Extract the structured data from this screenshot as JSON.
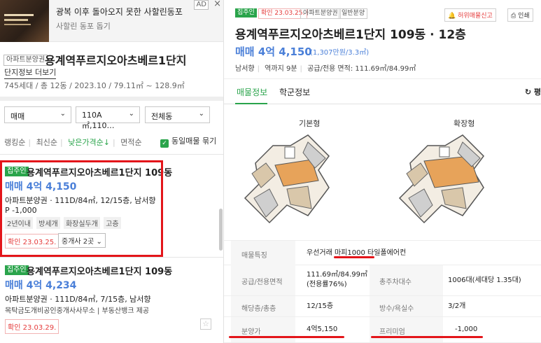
{
  "ad": {
    "title": "광복 이후 돌아오지 못한 사할린동포",
    "subtitle": "사할린 동포 돕기",
    "badge": "AD",
    "close": "×"
  },
  "complex": {
    "type_tag": "아파트분양권",
    "title": "용계역푸르지오아츠베르1단지",
    "star": "☆",
    "info_link": "단지정보 더보기",
    "info": "745세대 / 총 12동 / 2023.10 / 79.11㎡ ~ 128.9㎡"
  },
  "filters": {
    "deal": "매매",
    "area": "110A㎡,110…",
    "dong": "전체동"
  },
  "sort": {
    "items": [
      "랭킹순",
      "최신순",
      "낮은가격순↓",
      "면적순"
    ],
    "same_listing": "동일매물 묶기"
  },
  "listings": [
    {
      "tag": "집주인",
      "name": "용계역푸르지오아츠베르1단지 109동",
      "price": "매매 4억 4,150",
      "desc": "아파트분양권 · 111D/84㎡, 12/15층, 남서향",
      "premium": "P -1,000",
      "chips": [
        "2년이내",
        "방세개",
        "화장실두개",
        "고층"
      ],
      "confirm": "확인 23.03.25.",
      "agents": "중개사 2곳"
    },
    {
      "tag": "집주인",
      "name": "용계역푸르지오아츠베르1단지 109동",
      "price": "매매 4억 4,234",
      "desc": "아파트분양권 · 111D/84㎡, 7/15층, 남서향",
      "agency": "목탁금도개비공인중개사사무소 | 부동산뱅크 제공",
      "confirm": "확인 23.03.29."
    }
  ],
  "detail": {
    "tags": [
      "집주인",
      "확인 23.03.25.",
      "아파트분양권",
      "일반분양"
    ],
    "report_btn": "허위매물신고",
    "print_btn": "인쇄",
    "title": "용계역푸르지오아츠베르1단지 109동 · 12층",
    "price": "매매 4억 4,150",
    "price_sub": "(1,307만원/3.3㎡)",
    "info": [
      "남서향",
      "역까지 9분",
      "공급/전용 면적: 111.69㎡/84.99㎡"
    ],
    "tabs": [
      "매물정보",
      "학군정보"
    ],
    "refresh": "평",
    "plans": [
      "기본형",
      "확장형"
    ],
    "rows": [
      {
        "h1": "매물특징",
        "v1": "우선거래 마피1000 타일폴에어컨"
      },
      {
        "h1": "공급/전용면적",
        "v1": "111.69㎡/84.99㎡(전용률76%)",
        "h2": "총주차대수",
        "v2": "1006대(세대당 1.35대)"
      },
      {
        "h1": "해당층/총층",
        "v1": "12/15층",
        "h2": "방수/욕실수",
        "v2": "3/2개"
      },
      {
        "h1": "분양가",
        "v1": "4억5,150",
        "h2": "프리미엄",
        "v2": "-1,000"
      }
    ]
  },
  "colors": {
    "green": "#2aa44b",
    "price_blue": "#4a7fd8",
    "highlight_red": "#e3151a"
  }
}
